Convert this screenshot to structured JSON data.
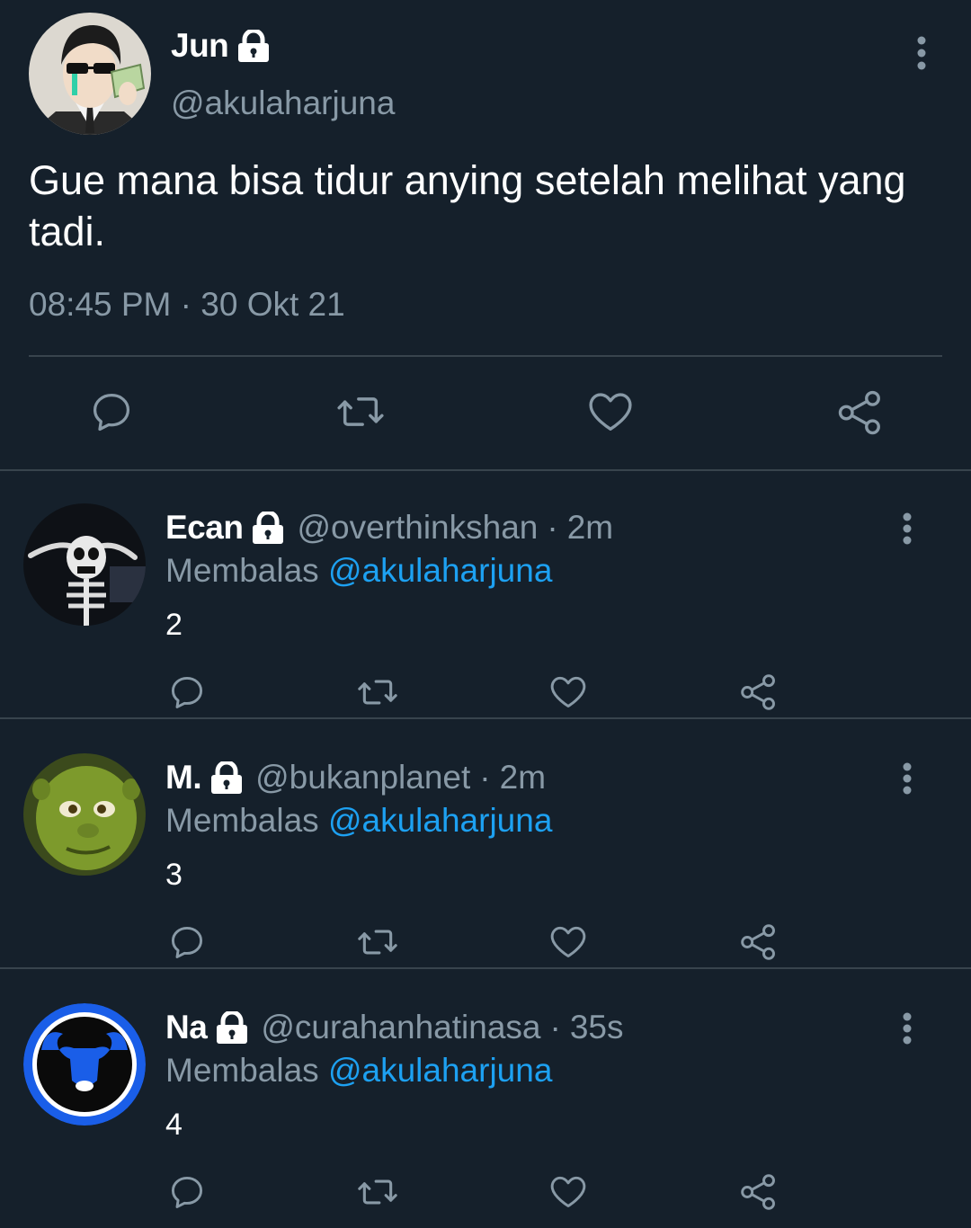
{
  "main_tweet": {
    "name": "Jun",
    "handle": "@akulaharjuna",
    "text": "Gue mana bisa tidur anying setelah melihat yang tadi.",
    "time": "08:45 PM",
    "separator": "·",
    "date": "30 Okt 21",
    "icons": [
      "reply-icon",
      "retweet-icon",
      "like-icon",
      "share-icon"
    ]
  },
  "replies": [
    {
      "name": "Ecan",
      "handle": "@overthinkshan",
      "age": "2m",
      "replying_label": "Membalas",
      "replying_to": "@akulaharjuna",
      "text": "2",
      "avatar": "skeleton"
    },
    {
      "name": "M.",
      "handle": "@bukanplanet",
      "age": "2m",
      "replying_label": "Membalas",
      "replying_to": "@akulaharjuna",
      "text": "3",
      "avatar": "green-ogre"
    },
    {
      "name": "Na",
      "handle": "@curahanhatinasa",
      "age": "35s",
      "replying_label": "Membalas",
      "replying_to": "@akulaharjuna",
      "text": "4",
      "avatar": "bull-logo"
    }
  ],
  "colors": {
    "background": "#15202b",
    "divider": "#38444d",
    "muted_text": "#8899a6",
    "link": "#1da1f2",
    "icon": "#8899a6"
  }
}
